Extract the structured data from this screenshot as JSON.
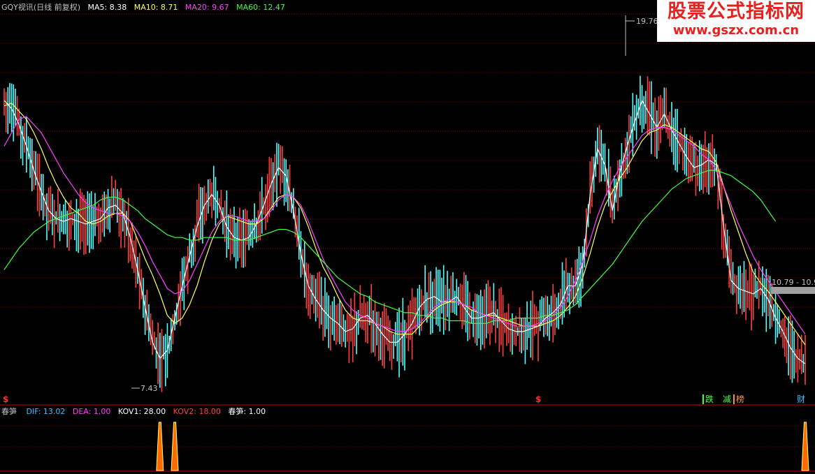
{
  "watermark": {
    "title": "股票公式指标网",
    "url": "www.gszx.com.cn"
  },
  "main_legend": {
    "title": "GQY视讯(日线 前复权)",
    "ma5": "MA5: 8.38",
    "ma10": "MA10: 8.71",
    "ma20": "MA20: 9.67",
    "ma60": "MA60: 12.47"
  },
  "sub_legend": {
    "name": "春笋",
    "dif": "DIF: 13.02",
    "dea": "DEA: 1.00",
    "kov1": "KOV1: 28.00",
    "kov2": "KOV2: 18.00",
    "signal": "春笋: 1.00"
  },
  "annotations": {
    "high_label": "19.76",
    "low_label": "7.43",
    "range_label": "10.79 - 10.9",
    "marker_left": "$",
    "marker_mid": "$",
    "tag_die": "跌",
    "tag_jian": "减",
    "tag_bang": "榜",
    "tag_cai": "财"
  },
  "colors": {
    "background": "#000000",
    "candle_up": "#ff4040",
    "candle_down": "#54ffff",
    "ma5": "#ffffff",
    "ma10": "#ffff60",
    "ma20": "#ff40ff",
    "ma60": "#40ff40",
    "grid": "#8b0000",
    "separator": "#c00000",
    "text_gray": "#c0c0c0"
  },
  "chart_data": [
    {
      "type": "candlestick",
      "ylim": [
        7.0,
        20.2
      ],
      "series": [
        {
          "name": "MA5",
          "values": [
            17.5,
            17.2,
            16.6,
            15.8,
            14.9,
            14.1,
            13.4,
            13.1,
            13.0,
            13.1,
            13.0,
            12.9,
            13.0,
            13.1,
            13.5,
            13.6,
            13.3,
            12.4,
            11.2,
            9.8,
            8.5,
            7.9,
            8.2,
            9.4,
            10.6,
            11.7,
            12.8,
            13.6,
            14.0,
            13.6,
            12.8,
            12.4,
            12.3,
            12.4,
            12.9,
            13.6,
            14.4,
            15.0,
            14.7,
            13.4,
            11.8,
            10.6,
            10.1,
            9.7,
            9.4,
            9.2,
            8.9,
            9.0,
            9.4,
            9.5,
            9.2,
            8.8,
            8.5,
            8.5,
            8.8,
            9.2,
            9.8,
            10.1,
            10.2,
            10.0,
            10.0,
            10.2,
            9.8,
            9.4,
            9.4,
            9.5,
            9.6,
            9.3,
            9.0,
            8.9,
            8.9,
            9.0,
            9.1,
            9.4,
            9.6,
            9.9,
            10.6,
            10.6,
            11.4,
            14.0,
            15.7,
            15.1,
            13.4,
            14.8,
            15.8,
            16.7,
            17.5,
            17.0,
            16.5,
            17.0,
            16.4,
            15.9,
            15.4,
            15.0,
            15.1,
            15.3,
            15.1,
            12.8,
            10.8,
            10.5,
            10.4,
            10.3,
            10.5,
            10.1,
            9.4,
            8.9,
            8.3,
            7.9,
            7.7
          ]
        },
        {
          "name": "MA10",
          "values": [
            17.3,
            17.4,
            17.1,
            16.8,
            16.3,
            15.7,
            15.0,
            14.4,
            13.9,
            13.5,
            13.3,
            13.0,
            12.9,
            13.0,
            13.2,
            13.3,
            13.3,
            13.0,
            12.3,
            11.6,
            11.0,
            10.3,
            9.5,
            9.2,
            9.4,
            9.9,
            10.6,
            11.5,
            12.3,
            12.9,
            13.2,
            13.1,
            13.0,
            12.9,
            12.9,
            13.1,
            13.5,
            13.9,
            14.0,
            13.9,
            13.5,
            12.8,
            12.0,
            11.3,
            10.8,
            10.2,
            9.7,
            9.4,
            9.3,
            9.3,
            9.2,
            9.1,
            8.9,
            8.8,
            8.8,
            8.8,
            9.1,
            9.4,
            9.7,
            9.9,
            10.0,
            10.0,
            9.9,
            9.7,
            9.6,
            9.5,
            9.5,
            9.4,
            9.3,
            9.2,
            9.1,
            9.1,
            9.1,
            9.2,
            9.3,
            9.5,
            9.8,
            10.2,
            10.9,
            11.8,
            12.8,
            13.6,
            14.1,
            14.6,
            15.0,
            15.5,
            16.0,
            16.3,
            16.4,
            16.6,
            16.5,
            16.3,
            16.1,
            15.9,
            15.7,
            15.6,
            15.2,
            14.3,
            13.4,
            12.6,
            11.8,
            11.1,
            10.7,
            10.4,
            10.0,
            9.6,
            9.2,
            8.8,
            8.4
          ]
        },
        {
          "name": "MA20",
          "values": [
            15.8,
            16.3,
            16.8,
            16.9,
            16.6,
            16.3,
            15.8,
            15.3,
            14.8,
            14.4,
            14.0,
            13.7,
            13.5,
            13.4,
            13.3,
            13.3,
            13.2,
            13.0,
            12.6,
            12.1,
            11.5,
            11.0,
            10.5,
            10.3,
            10.4,
            10.8,
            11.4,
            12.0,
            12.6,
            13.0,
            13.2,
            13.2,
            13.1,
            13.0,
            13.0,
            13.1,
            13.4,
            13.8,
            14.0,
            13.9,
            13.6,
            13.0,
            12.3,
            11.6,
            11.0,
            10.5,
            10.0,
            9.7,
            9.5,
            9.4,
            9.2,
            9.1,
            9.0,
            8.9,
            8.9,
            9.0,
            9.2,
            9.5,
            9.8,
            10.0,
            10.1,
            10.0,
            9.9,
            9.8,
            9.6,
            9.5,
            9.4,
            9.3,
            9.2,
            9.1,
            9.1,
            9.1,
            9.2,
            9.3,
            9.5,
            9.8,
            10.2,
            10.8,
            11.5,
            12.3,
            13.2,
            13.9,
            14.5,
            15.0,
            15.4,
            15.8,
            16.2,
            16.4,
            16.5,
            16.5,
            16.4,
            16.2,
            16.0,
            15.8,
            15.5,
            15.3,
            14.9,
            14.3,
            13.6,
            12.9,
            12.3,
            11.7,
            11.2,
            10.8,
            10.4,
            10.0,
            9.6,
            9.2,
            8.8
          ]
        },
        {
          "name": "MA60",
          "values": [
            11.2,
            11.6,
            12.0,
            12.3,
            12.6,
            12.8,
            13.0,
            13.1,
            13.2,
            13.3,
            13.4,
            13.5,
            13.6,
            13.8,
            13.9,
            13.9,
            13.8,
            13.6,
            13.4,
            13.1,
            12.9,
            12.7,
            12.5,
            12.4,
            12.4,
            12.3,
            12.3,
            12.4,
            12.4,
            12.4,
            12.4,
            12.3,
            12.3,
            12.3,
            12.4,
            12.5,
            12.6,
            12.7,
            12.7,
            12.6,
            12.4,
            12.1,
            11.8,
            11.5,
            11.2,
            10.9,
            10.7,
            10.5,
            10.3,
            10.2,
            10.0,
            9.9,
            9.8,
            9.7,
            9.6,
            9.6,
            9.5,
            9.5,
            9.4,
            9.4,
            9.3,
            9.3,
            9.3,
            9.2,
            9.2,
            9.2,
            9.3,
            9.3,
            9.3,
            9.4,
            9.4,
            9.4,
            9.4,
            9.5,
            9.5,
            9.6,
            9.7,
            9.9,
            10.2,
            10.5,
            10.8,
            11.1,
            11.4,
            11.8,
            12.2,
            12.6,
            13.0,
            13.3,
            13.6,
            13.9,
            14.2,
            14.4,
            14.6,
            14.7,
            14.8,
            14.9,
            14.9,
            14.8,
            14.7,
            14.5,
            14.3,
            14.1,
            13.8,
            13.4,
            13.0
          ]
        }
      ],
      "annotations": [
        {
          "label": "19.76",
          "value": 19.76
        },
        {
          "label": "7.43",
          "value": 7.43
        }
      ]
    },
    {
      "type": "line",
      "ylim": [
        0,
        30
      ],
      "series": [
        {
          "name": "春笋",
          "values": [
            0,
            0,
            0,
            0,
            0,
            0,
            0,
            0,
            0,
            0,
            0,
            0,
            0,
            0,
            0,
            0,
            0,
            0,
            0,
            0,
            0,
            28,
            0,
            28,
            0,
            0,
            0,
            0,
            0,
            0,
            0,
            0,
            0,
            0,
            0,
            0,
            0,
            0,
            0,
            0,
            0,
            0,
            0,
            0,
            0,
            0,
            0,
            0,
            0,
            0,
            0,
            0,
            0,
            0,
            0,
            0,
            0,
            0,
            0,
            0,
            0,
            0,
            0,
            0,
            0,
            0,
            0,
            0,
            0,
            0,
            0,
            0,
            0,
            0,
            0,
            0,
            0,
            0,
            0,
            0,
            0,
            0,
            0,
            0,
            0,
            0,
            0,
            0,
            0,
            0,
            0,
            0,
            0,
            0,
            0,
            0,
            0,
            0,
            0,
            0,
            0,
            0,
            0,
            0,
            0,
            0,
            0,
            0,
            28
          ]
        }
      ]
    }
  ]
}
